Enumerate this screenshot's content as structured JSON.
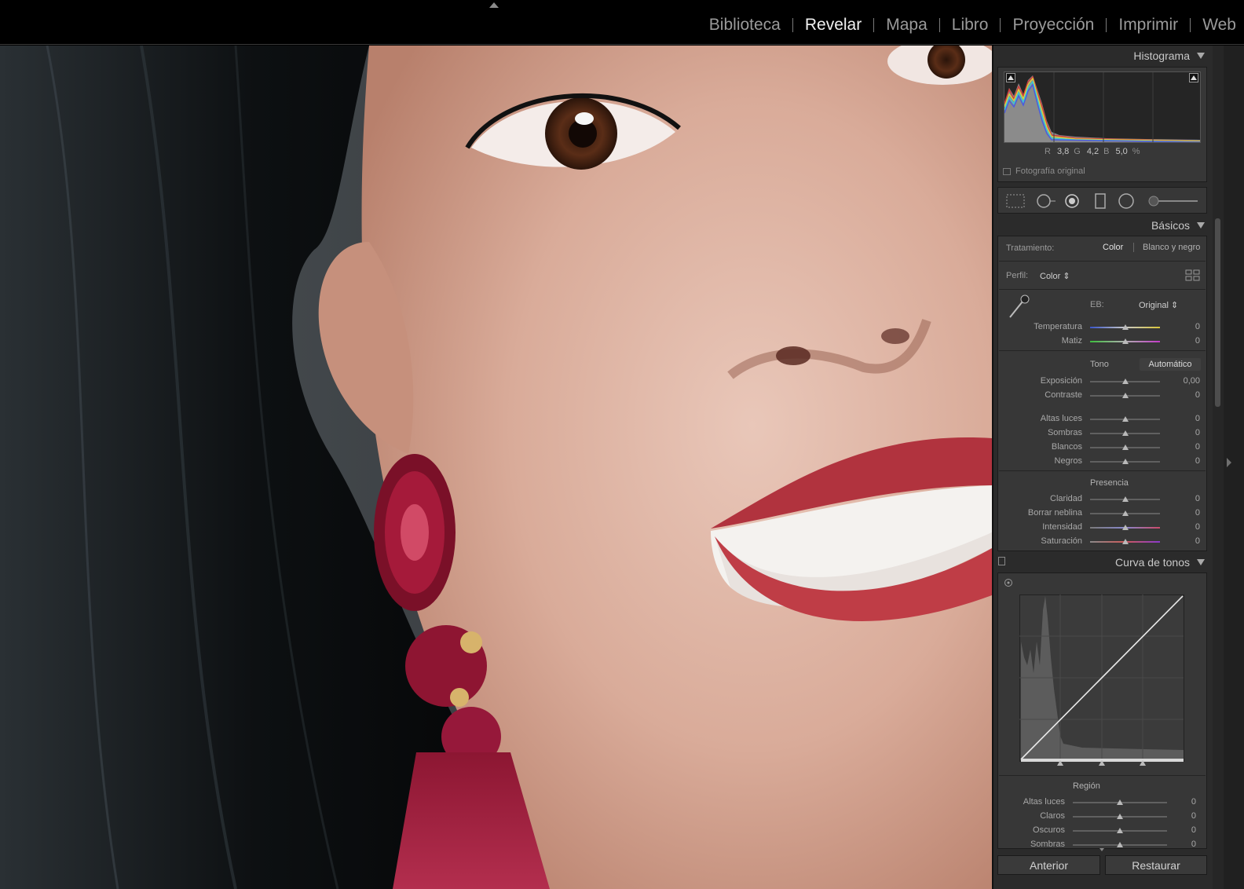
{
  "modules": [
    {
      "label": "Biblioteca",
      "active": false
    },
    {
      "label": "Revelar",
      "active": true
    },
    {
      "label": "Mapa",
      "active": false
    },
    {
      "label": "Libro",
      "active": false
    },
    {
      "label": "Proyección",
      "active": false
    },
    {
      "label": "Imprimir",
      "active": false
    },
    {
      "label": "Web",
      "active": false
    }
  ],
  "histogram": {
    "title": "Histograma",
    "r_label": "R",
    "r_value": "3,8",
    "g_label": "G",
    "g_value": "4,2",
    "b_label": "B",
    "b_value": "5,0",
    "percent": "%",
    "original_photo": "Fotografía original"
  },
  "tool_icons": [
    "crop-overlay-icon",
    "spot-removal-icon",
    "red-eye-icon",
    "graduated-filter-icon",
    "radial-filter-icon",
    "adjustment-brush-icon"
  ],
  "basic": {
    "title": "Básicos",
    "treatment_label": "Tratamiento:",
    "treatment_color": "Color",
    "treatment_bw": "Blanco y negro",
    "profile_label": "Perfil:",
    "profile_value": "Color",
    "wb_label": "EB:",
    "wb_value": "Original",
    "tone_label": "Tono",
    "auto_label": "Automático",
    "presence_label": "Presencia",
    "sliders": {
      "temperature": {
        "label": "Temperatura",
        "value": "0",
        "position": 0.5
      },
      "tint": {
        "label": "Matiz",
        "value": "0",
        "position": 0.5
      },
      "exposure": {
        "label": "Exposición",
        "value": "0,00",
        "position": 0.5
      },
      "contrast": {
        "label": "Contraste",
        "value": "0",
        "position": 0.5
      },
      "highlights": {
        "label": "Altas luces",
        "value": "0",
        "position": 0.5
      },
      "shadows": {
        "label": "Sombras",
        "value": "0",
        "position": 0.5
      },
      "whites": {
        "label": "Blancos",
        "value": "0",
        "position": 0.5
      },
      "blacks": {
        "label": "Negros",
        "value": "0",
        "position": 0.5
      },
      "clarity": {
        "label": "Claridad",
        "value": "0",
        "position": 0.5
      },
      "dehaze": {
        "label": "Borrar neblina",
        "value": "0",
        "position": 0.5
      },
      "vibrance": {
        "label": "Intensidad",
        "value": "0",
        "position": 0.5
      },
      "saturation": {
        "label": "Saturación",
        "value": "0",
        "position": 0.5
      }
    }
  },
  "tone_curve": {
    "title": "Curva de tonos",
    "region_label": "Región",
    "sliders": {
      "highlights": {
        "label": "Altas luces",
        "value": "0",
        "position": 0.5
      },
      "lights": {
        "label": "Claros",
        "value": "0",
        "position": 0.5
      },
      "darks": {
        "label": "Oscuros",
        "value": "0",
        "position": 0.5
      },
      "shadows": {
        "label": "Sombras",
        "value": "0",
        "position": 0.5
      }
    }
  },
  "buttons": {
    "previous": "Anterior",
    "reset": "Restaurar"
  }
}
